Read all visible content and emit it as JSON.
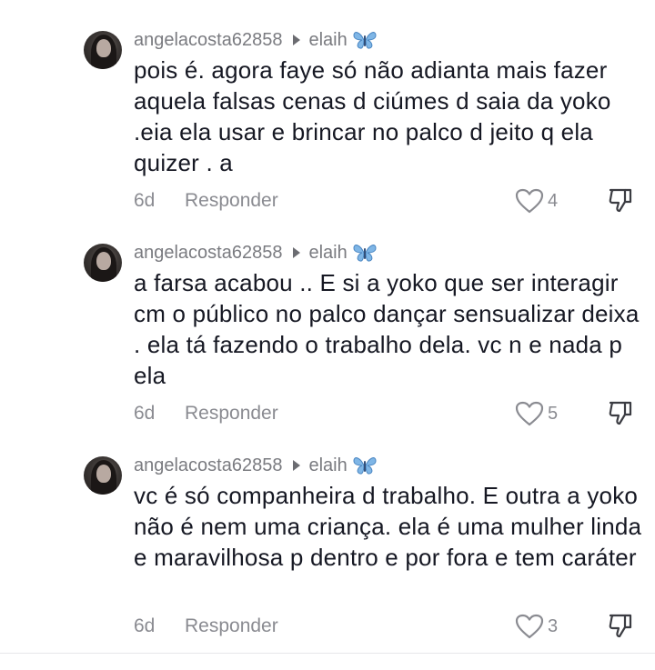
{
  "comments": [
    {
      "username": "angelacosta62858",
      "reply_to": "elaih",
      "reply_to_emoji": "butterfly",
      "text": "pois é. agora faye só não adianta mais fazer aquela falsas cenas d ciúmes d saia da yoko .eia ela usar e brincar no palco d jeito q ela quizer . a",
      "time": "6d",
      "reply_label": "Responder",
      "likes": "4"
    },
    {
      "username": "angelacosta62858",
      "reply_to": "elaih",
      "reply_to_emoji": "butterfly",
      "text": "a farsa acabou .. E si a yoko que ser interagir cm o público no palco dançar sensualizar deixa . ela tá fazendo o trabalho dela. vc n e nada p ela",
      "time": "6d",
      "reply_label": "Responder",
      "likes": "5"
    },
    {
      "username": "angelacosta62858",
      "reply_to": "elaih",
      "reply_to_emoji": "butterfly",
      "text": "vc é só companheira d trabalho. E outra a yoko não é nem uma criança. ela é uma mulher linda e maravilhosa p dentro e por fora e tem caráter",
      "time": "6d",
      "reply_label": "Responder",
      "likes": "3"
    }
  ],
  "icons": {
    "like": "heart-outline-icon",
    "dislike": "thumbs-down-icon",
    "reply_arrow": "play-arrow-icon",
    "emoji": "butterfly-emoji"
  },
  "colors": {
    "text": "#161823",
    "muted": "#8a8b91",
    "butterfly": "#7fb6e6"
  }
}
